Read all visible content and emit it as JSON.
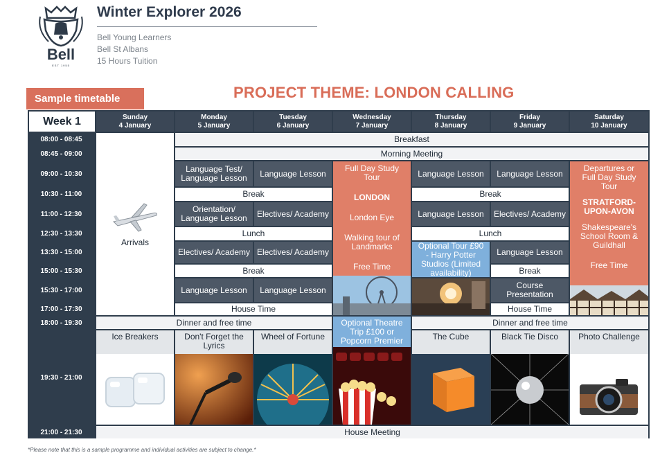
{
  "header": {
    "logo_text": "Bell",
    "logo_est": "EST 1955",
    "title": "Winter Explorer 2026",
    "lines": [
      "Bell Young Learners",
      "Bell St Albans",
      "15 Hours Tuition"
    ]
  },
  "badge": "Sample timetable",
  "theme": "PROJECT THEME: LONDON CALLING",
  "week_label": "Week 1",
  "days": [
    {
      "name": "Sunday",
      "date": "4 January"
    },
    {
      "name": "Monday",
      "date": "5 January"
    },
    {
      "name": "Tuesday",
      "date": "6 January"
    },
    {
      "name": "Wednesday",
      "date": "7 January"
    },
    {
      "name": "Thursday",
      "date": "8 January"
    },
    {
      "name": "Friday",
      "date": "9 January"
    },
    {
      "name": "Saturday",
      "date": "10 January"
    }
  ],
  "times": [
    "08:00 - 08:45",
    "08:45 - 09:00",
    "09:00 - 10:30",
    "10:30 - 11:00",
    "11:00 - 12:30",
    "12:30 - 13:30",
    "13:30 - 15:00",
    "15:00 - 15:30",
    "15:30 - 17:00",
    "17:00 - 17:30",
    "18:00 - 19:30",
    "19:30 - 21:00",
    "21:00 - 21:30"
  ],
  "sunday": "Arrivals",
  "breakfast": "Breakfast",
  "morning_meeting": "Morning Meeting",
  "mon": {
    "s1": "Language Test/ Language Lesson",
    "brk": "Break",
    "s2": "Orientation/ Language Lesson",
    "lunch": "Lunch",
    "s3": "Electives/ Academy",
    "brk2": "Break",
    "s4": "Language Lesson",
    "house": "House Time"
  },
  "tue": {
    "s1": "Language Lesson",
    "s2": "Electives/ Academy",
    "s3": "Electives/ Academy",
    "s4": "Language Lesson"
  },
  "wed": {
    "l1": "Full Day Study Tour",
    "l2": "LONDON",
    "l3": "London Eye",
    "l4": "Walking tour of Landmarks",
    "l5": "Free Time"
  },
  "thu": {
    "s1": "Language Lesson",
    "brk": "Break",
    "s2": "Language Lesson",
    "lunch": "Lunch",
    "s3": "Optional Tour £90 - Harry Potter Studios (Limited availability)"
  },
  "fri": {
    "s1": "Language Lesson",
    "s2": "Electives/ Academy",
    "s3": "Language Lesson",
    "brk2": "Break",
    "s4": "Course Presentation",
    "house": "House Time"
  },
  "sat": {
    "l1": "Departures or Full Day Study Tour",
    "l2": "STRATFORD-UPON-AVON",
    "l3": "Shakespeare's School Room & Guildhall",
    "l4": "Free Time"
  },
  "dinner": "Dinner and free time",
  "wed_theatre": "Optional Theatre Trip £100 or Popcorn Premier",
  "evening": {
    "sun": "Ice Breakers",
    "mon": "Don't Forget the Lyrics",
    "tue": "Wheel of Fortune",
    "thu": "The Cube",
    "fri": "Black Tie Disco",
    "sat": "Photo Challenge"
  },
  "house_meeting": "House Meeting",
  "footnote": "*Please note that this is a sample programme and individual activities are subject to change.*",
  "colors": {
    "navy": "#2f3d4c",
    "coral": "#e07f68",
    "blue": "#7fb0dc",
    "accent_red": "#d96d58"
  }
}
